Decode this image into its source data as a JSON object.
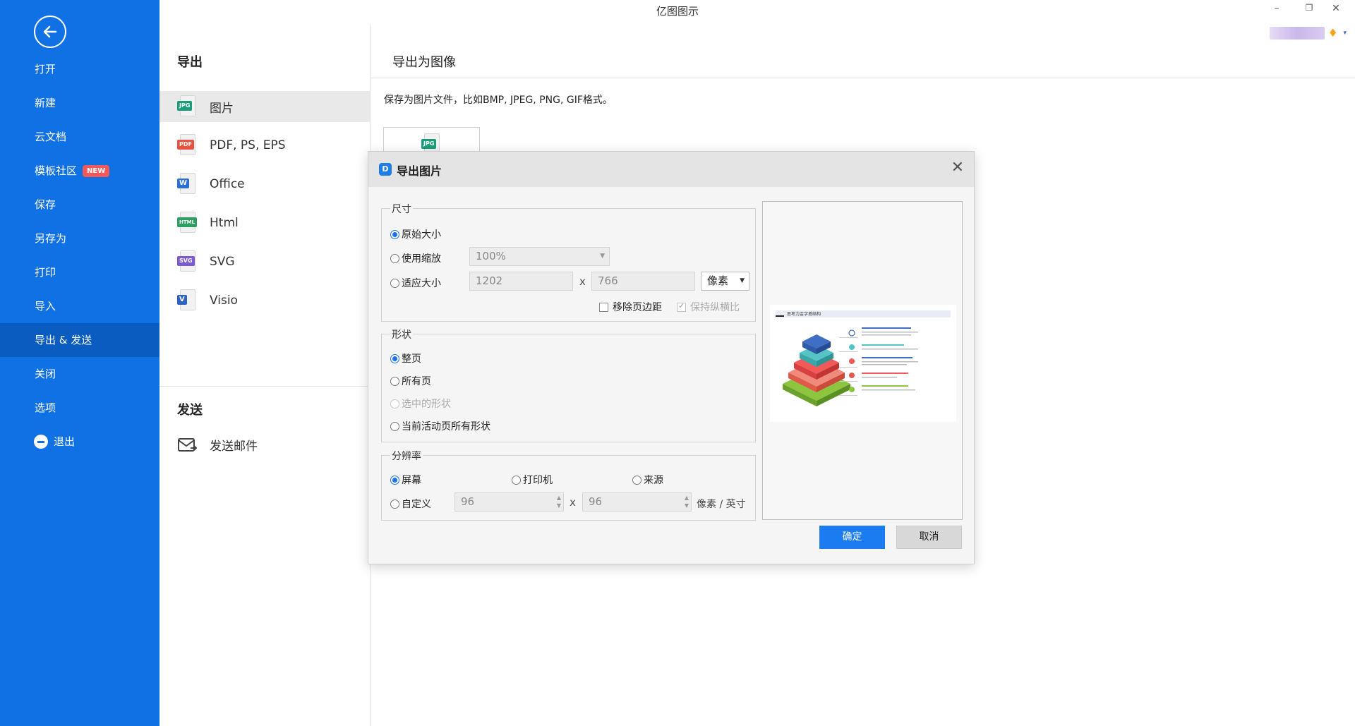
{
  "window": {
    "title": "亿图图示",
    "min_glyph": "–",
    "restore_glyph": "❐",
    "close_glyph": "✕"
  },
  "sidebar": {
    "items": [
      {
        "label": "打开"
      },
      {
        "label": "新建"
      },
      {
        "label": "云文档"
      },
      {
        "label": "模板社区",
        "badge": "NEW"
      },
      {
        "label": "保存"
      },
      {
        "label": "另存为"
      },
      {
        "label": "打印"
      },
      {
        "label": "导入"
      },
      {
        "label": "导出 & 发送",
        "active": true
      },
      {
        "label": "关闭"
      },
      {
        "label": "选项"
      },
      {
        "label": "退出"
      }
    ]
  },
  "export_panel": {
    "title": "导出",
    "formats": [
      {
        "label": "图片",
        "icon": "jpg-file-icon",
        "tag": "JPG",
        "color": "#1a9e7a"
      },
      {
        "label": "PDF, PS, EPS",
        "icon": "pdf-file-icon",
        "tag": "PDF",
        "color": "#e8523f"
      },
      {
        "label": "Office",
        "icon": "word-file-icon",
        "tag": "W",
        "color": "#2b6fd6"
      },
      {
        "label": "Html",
        "icon": "html-file-icon",
        "tag": "HTML",
        "color": "#2f9e63"
      },
      {
        "label": "SVG",
        "icon": "svg-file-icon",
        "tag": "SVG",
        "color": "#7a5bd1"
      },
      {
        "label": "Visio",
        "icon": "visio-file-icon",
        "tag": "V",
        "color": "#2b62c4"
      }
    ]
  },
  "send_panel": {
    "title": "发送",
    "items": [
      {
        "label": "发送邮件"
      }
    ]
  },
  "content": {
    "heading": "导出为图像",
    "description": "保存为图片文件，比如BMP, JPEG, PNG, GIF格式。",
    "card_tag": "JPG"
  },
  "dialog": {
    "title": "导出图片",
    "logo_glyph": "D",
    "close_glyph": "✕",
    "size_group": {
      "title": "尺寸",
      "original": "原始大小",
      "zoom": "使用缩放",
      "zoom_value": "100%",
      "fit": "适应大小",
      "width": "1202",
      "height": "766",
      "x": "x",
      "unit": "像素",
      "remove_margin": "移除页边距",
      "keep_ratio": "保持纵横比"
    },
    "shape_group": {
      "title": "形状",
      "whole_page": "整页",
      "all_pages": "所有页",
      "selected": "选中的形状",
      "current_page_all": "当前活动页所有形状"
    },
    "resolution_group": {
      "title": "分辨率",
      "screen": "屏幕",
      "printer": "打印机",
      "source": "来源",
      "custom": "自定义",
      "dpi_x": "96",
      "dpi_y": "96",
      "x": "x",
      "unit": "像素 / 英寸"
    },
    "preview_title": "思考力金字塔结构",
    "ok": "确定",
    "cancel": "取消"
  },
  "colors": {
    "sidebar_bg": "#1071e5",
    "sidebar_active": "#0a5cc1",
    "primary_button": "#1a7cf0"
  }
}
